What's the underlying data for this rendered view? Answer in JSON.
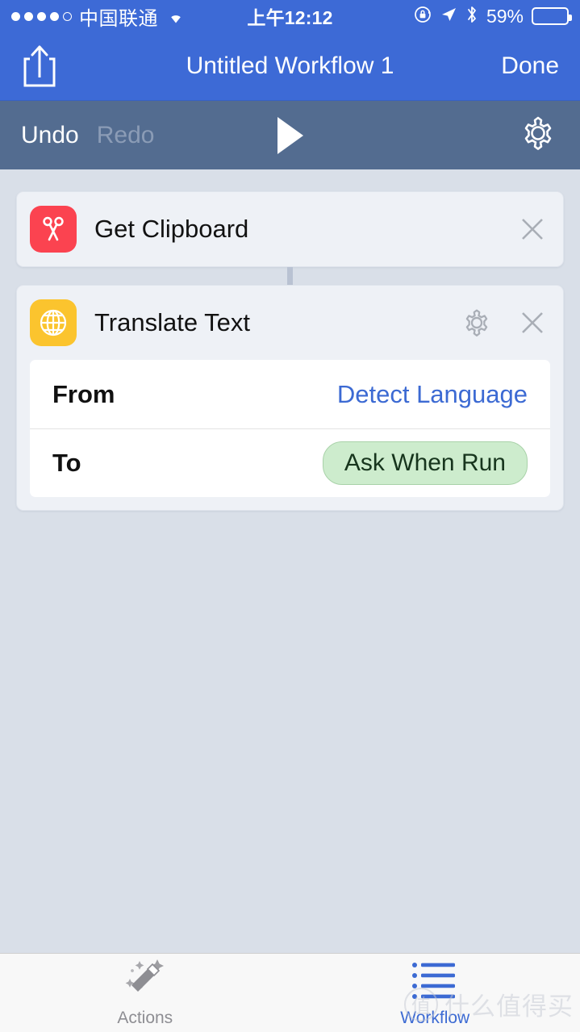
{
  "status_bar": {
    "signal_dots_filled": 4,
    "signal_dots_total": 5,
    "carrier": "中国联通",
    "wifi_icon": "wifi-icon",
    "time": "上午12:12",
    "rotation_lock_icon": "rotation-lock-icon",
    "location_icon": "location-arrow-icon",
    "bluetooth_icon": "bluetooth-icon",
    "battery_percent": "59%",
    "battery_level": 59
  },
  "nav_bar": {
    "share_icon": "share-icon",
    "title": "Untitled Workflow 1",
    "done_label": "Done",
    "background_color": "#3d6ad6"
  },
  "toolbar": {
    "undo_label": "Undo",
    "redo_label": "Redo",
    "redo_disabled": true,
    "play_icon": "play-icon",
    "settings_icon": "gear-icon",
    "background_color": "#536c90"
  },
  "workflow": {
    "actions": [
      {
        "icon_name": "scissors-icon",
        "icon_color": "#fb4350",
        "title": "Get Clipboard",
        "has_settings": false,
        "close_icon": "close-icon"
      },
      {
        "icon_name": "globe-icon",
        "icon_color": "#fbc42e",
        "title": "Translate Text",
        "has_settings": true,
        "settings_icon": "gear-icon",
        "close_icon": "close-icon",
        "parameters": [
          {
            "label": "From",
            "value": "Detect Language",
            "style": "link"
          },
          {
            "label": "To",
            "value": "Ask When Run",
            "style": "pill"
          }
        ]
      }
    ]
  },
  "tab_bar": {
    "tabs": [
      {
        "label": "Actions",
        "icon_name": "magic-wand-icon",
        "active": false
      },
      {
        "label": "Workflow",
        "icon_name": "list-icon",
        "active": true
      }
    ],
    "active_color": "#3c6ad3",
    "inactive_color": "#8e8e93"
  },
  "watermark": {
    "logo_text": "值",
    "text": "什么值得买"
  }
}
